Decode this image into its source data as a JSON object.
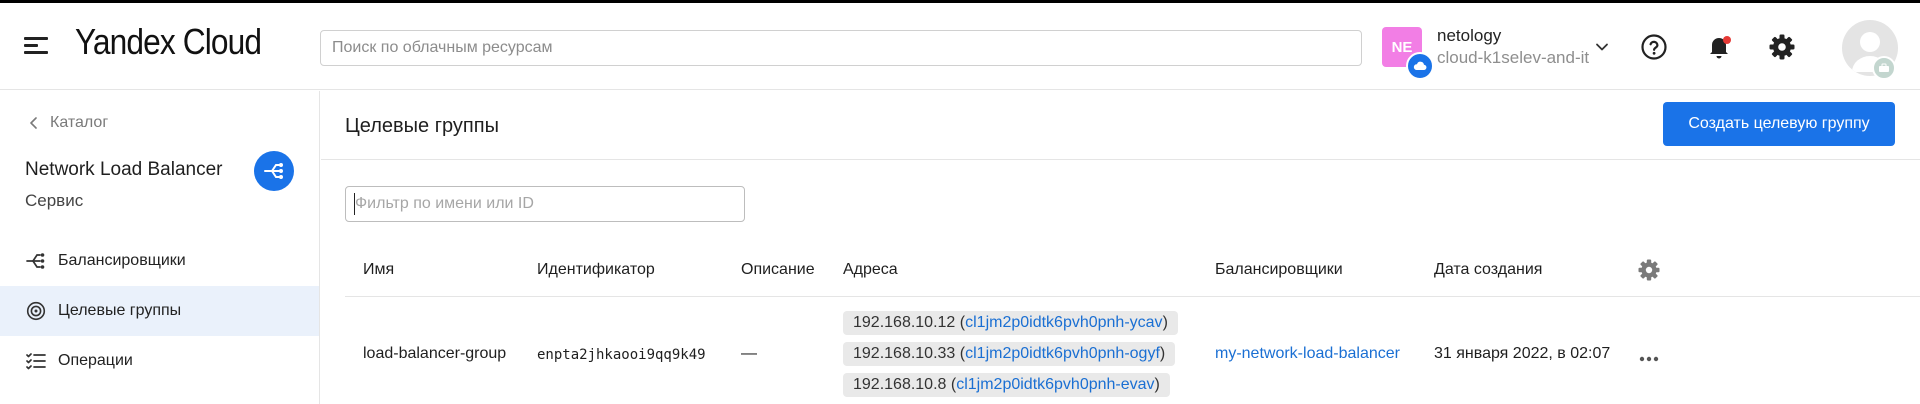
{
  "header": {
    "logo": "Yandex Cloud",
    "search_placeholder": "Поиск по облачным ресурсам",
    "org_initials": "NE",
    "org_name": "netology",
    "cloud_name": "cloud-k1selev-and-it",
    "icons": [
      "menu-icon",
      "help-icon",
      "bell-icon",
      "gear-icon",
      "user-avatar"
    ],
    "accent_color": "#1a73e8",
    "org_color": "#f27ee5",
    "notification_color": "#e53935"
  },
  "sidebar": {
    "back_label": "Каталог",
    "service_title": "Network Load Balancer",
    "service_subtitle": "Сервис",
    "items": [
      {
        "label": "Балансировщики",
        "icon": "balancer-icon",
        "active": false
      },
      {
        "label": "Целевые группы",
        "icon": "target-icon",
        "active": true
      },
      {
        "label": "Операции",
        "icon": "operations-icon",
        "active": false
      }
    ]
  },
  "main": {
    "title": "Целевые группы",
    "create_button": "Создать целевую группу",
    "filter_placeholder": "Фильтр по имени или ID",
    "columns": [
      "Имя",
      "Идентификатор",
      "Описание",
      "Адреса",
      "Балансировщики",
      "Дата создания"
    ],
    "rows": [
      {
        "name": "load-balancer-group",
        "id": "enpta2jhkaooi9qq9k49",
        "description": "—",
        "addresses": [
          {
            "ip": "192.168.10.12",
            "instance": "cl1jm2p0idtk6pvh0pnh-ycav"
          },
          {
            "ip": "192.168.10.33",
            "instance": "cl1jm2p0idtk6pvh0pnh-ogyf"
          },
          {
            "ip": "192.168.10.8",
            "instance": "cl1jm2p0idtk6pvh0pnh-evav"
          }
        ],
        "balancer": "my-network-load-balancer",
        "created": "31 января 2022, в 02:07"
      }
    ]
  }
}
